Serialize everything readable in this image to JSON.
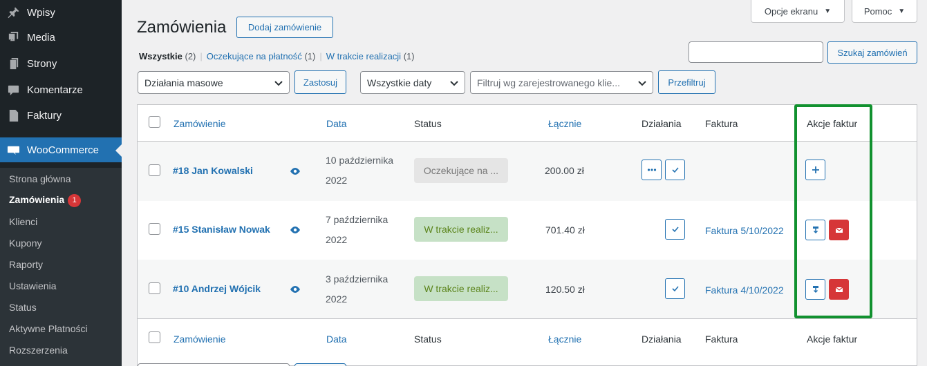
{
  "sidebar": {
    "menu": [
      {
        "label": "Wpisy",
        "icon": "pin-icon"
      },
      {
        "label": "Media",
        "icon": "media-icon"
      },
      {
        "label": "Strony",
        "icon": "pages-icon"
      },
      {
        "label": "Komentarze",
        "icon": "comments-icon"
      },
      {
        "label": "Faktury",
        "icon": "invoices-icon"
      }
    ],
    "woocommerce": {
      "label": "WooCommerce",
      "icon": "woo-icon"
    },
    "submenu": [
      {
        "label": "Strona główna"
      },
      {
        "label": "Zamówienia",
        "badge": "1"
      },
      {
        "label": "Klienci"
      },
      {
        "label": "Kupony"
      },
      {
        "label": "Raporty"
      },
      {
        "label": "Ustawienia"
      },
      {
        "label": "Status"
      },
      {
        "label": "Aktywne Płatności"
      },
      {
        "label": "Rozszerzenia"
      }
    ]
  },
  "top_buttons": {
    "screen_options": "Opcje ekranu",
    "help": "Pomoc"
  },
  "header": {
    "title": "Zamówienia",
    "add_order": "Dodaj zamówienie"
  },
  "filters_links": [
    {
      "label": "Wszystkie",
      "count": "(2)"
    },
    {
      "label": "Oczekujące na płatność",
      "count": "(1)"
    },
    {
      "label": "W trakcie realizacji",
      "count": "(1)"
    }
  ],
  "search": {
    "value": "",
    "button": "Szukaj zamówień"
  },
  "toolbar": {
    "bulk_actions": "Działania masowe",
    "apply": "Zastosuj",
    "dates": "Wszystkie daty",
    "customer_filter_placeholder": "Filtruj wg zarejestrowanego klie...",
    "filter": "Przefiltruj"
  },
  "columns": {
    "order": "Zamówienie",
    "date": "Data",
    "status": "Status",
    "total": "Łącznie",
    "actions": "Działania",
    "invoice": "Faktura",
    "invoice_actions": "Akcje faktur"
  },
  "orders": [
    {
      "order": "#18 Jan Kowalski",
      "date_line1": "10 października",
      "date_line2": "2022",
      "status": "Oczekujące na ...",
      "status_type": "pending",
      "total": "200.00 zł",
      "invoice": ""
    },
    {
      "order": "#15 Stanisław Nowak",
      "date_line1": "7 października",
      "date_line2": "2022",
      "status": "W trakcie realiz...",
      "status_type": "processing",
      "total": "701.40 zł",
      "invoice": "Faktura 5/10/2022"
    },
    {
      "order": "#10 Andrzej Wójcik",
      "date_line1": "3 października",
      "date_line2": "2022",
      "status": "W trakcie realiz...",
      "status_type": "processing",
      "total": "120.50 zł",
      "invoice": "Faktura 4/10/2022"
    }
  ],
  "colors": {
    "accent": "#2271b1",
    "sidebar_bg": "#1d2327",
    "highlight": "#11912f",
    "badge": "#d63638",
    "processing_bg": "#c6e1c6",
    "processing_text": "#5b841b",
    "pending_bg": "#e5e5e5"
  }
}
